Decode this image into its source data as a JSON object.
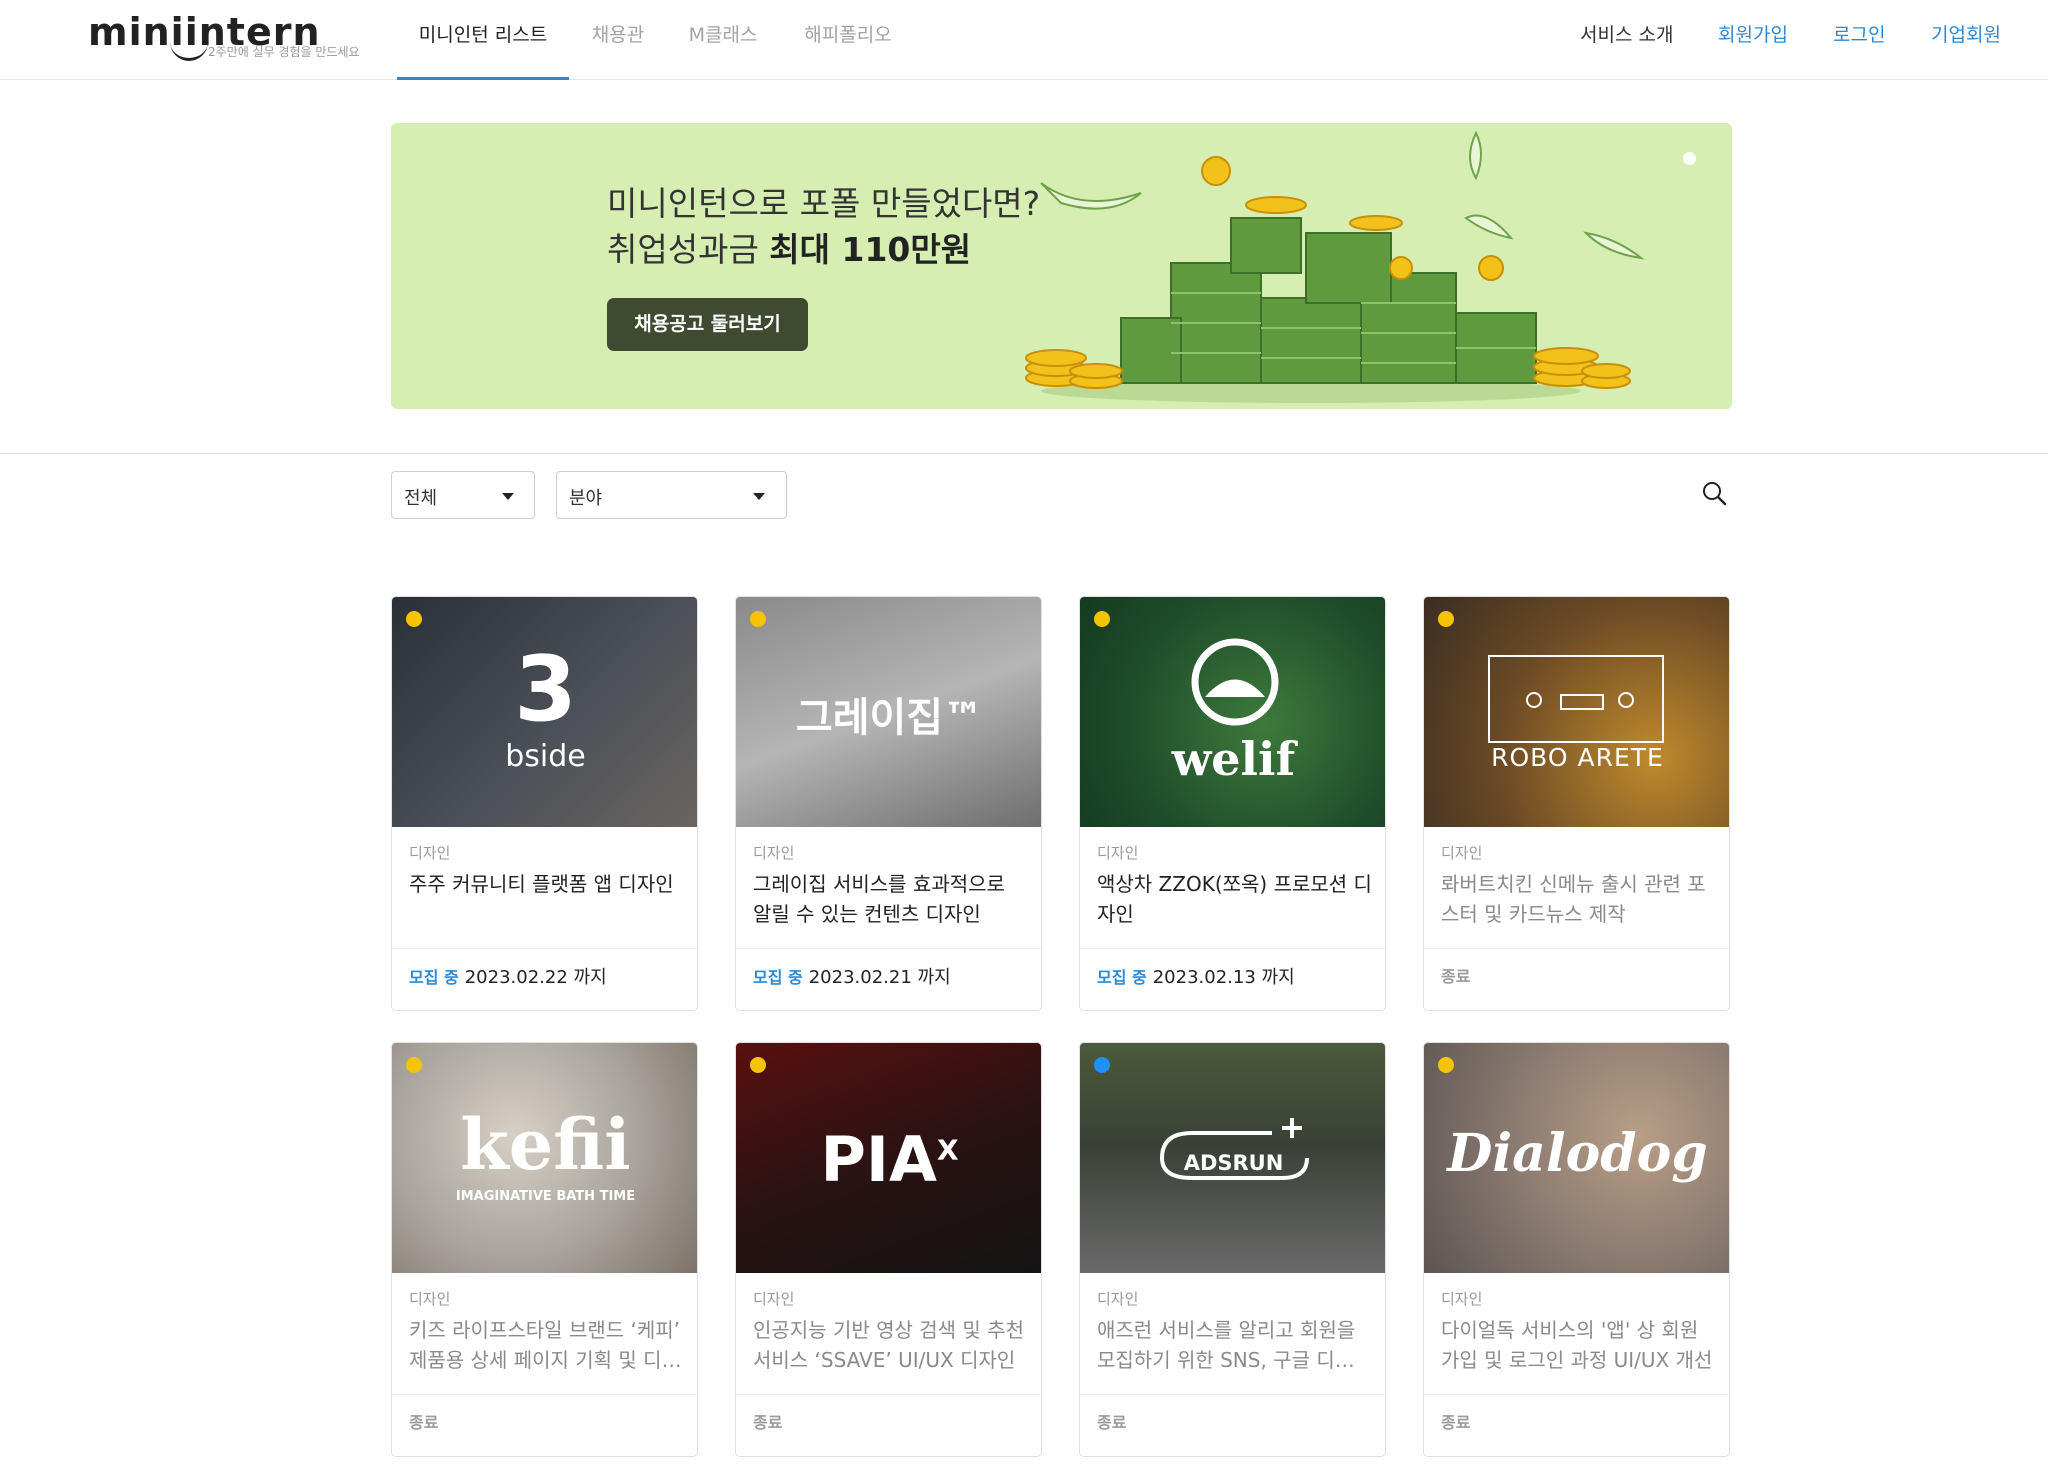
{
  "header": {
    "logo_text": "miniintern",
    "logo_tagline": "2주만에 실무 경험을 만드세요",
    "tabs": [
      {
        "label": "미니인턴 리스트",
        "active": true
      },
      {
        "label": "채용관",
        "active": false
      },
      {
        "label": "M클래스",
        "active": false
      },
      {
        "label": "해피폴리오",
        "active": false
      }
    ],
    "right_links": [
      {
        "label": "서비스 소개"
      },
      {
        "label": "회원가입"
      },
      {
        "label": "로그인"
      },
      {
        "label": "기업회원"
      }
    ]
  },
  "banner": {
    "line1": "미니인턴으로 포폴 만들었다면?",
    "line2_prefix": "취업성과금 ",
    "line2_bold": "최대 110만원",
    "button_label": "채용공고 둘러보기",
    "background_color": "#d6eeb2"
  },
  "filters": {
    "status_select": "전체",
    "field_select": "분야",
    "search_icon": "search-icon"
  },
  "colors": {
    "accent": "#2b8ad6",
    "dot_yellow": "#f5c400",
    "dot_blue": "#1e90ff"
  },
  "cards": [
    {
      "brand": "bside",
      "brand_mark": "3",
      "category": "디자인",
      "title": "주주 커뮤니티 플랫폼 앱 디자인",
      "status": "모집 중",
      "deadline": "2023.02.22 까지",
      "dot": "yellow"
    },
    {
      "brand": "그레이집™",
      "category": "디자인",
      "title": "그레이집 서비스를 효과적으로 알릴 수 있는 컨텐츠 디자인",
      "status": "모집 중",
      "deadline": "2023.02.21 까지",
      "dot": "yellow"
    },
    {
      "brand": "welif",
      "category": "디자인",
      "title": "액상차 ZZOK(쪼옥) 프로모션 디자인",
      "status": "모집 중",
      "deadline": "2023.02.13 까지",
      "dot": "yellow"
    },
    {
      "brand": "ROBO ARETE",
      "category": "디자인",
      "title": "롸버트치킨 신메뉴 출시 관련 포스터 및 카드뉴스 제작",
      "status": "종료",
      "deadline": "",
      "dot": "yellow"
    },
    {
      "brand": "kefii",
      "brand_sub": "IMAGINATIVE BATH TIME",
      "category": "디자인",
      "title": "키즈 라이프스타일 브랜드 ‘케피’ 제품용 상세 페이지 기획 및 디자인",
      "status": "종료",
      "deadline": "",
      "dot": "yellow"
    },
    {
      "brand": "PIA",
      "brand_sup": "X",
      "category": "디자인",
      "title": "인공지능 기반 영상 검색 및 추천 서비스 ‘SSAVE’ UI/UX 디자인",
      "status": "종료",
      "deadline": "",
      "dot": "yellow"
    },
    {
      "brand": "ADSRUN",
      "category": "디자인",
      "title": "애즈런 서비스를 알리고 회원을 모집하기 위한 SNS, 구글 디스플레이 광고",
      "status": "종료",
      "deadline": "",
      "dot": "blue"
    },
    {
      "brand": "Dialodog",
      "category": "디자인",
      "title": "다이얼독 서비스의 '앱' 상 회원가입 및 로그인 과정 UI/UX 개선",
      "status": "종료",
      "deadline": "",
      "dot": "yellow"
    }
  ]
}
